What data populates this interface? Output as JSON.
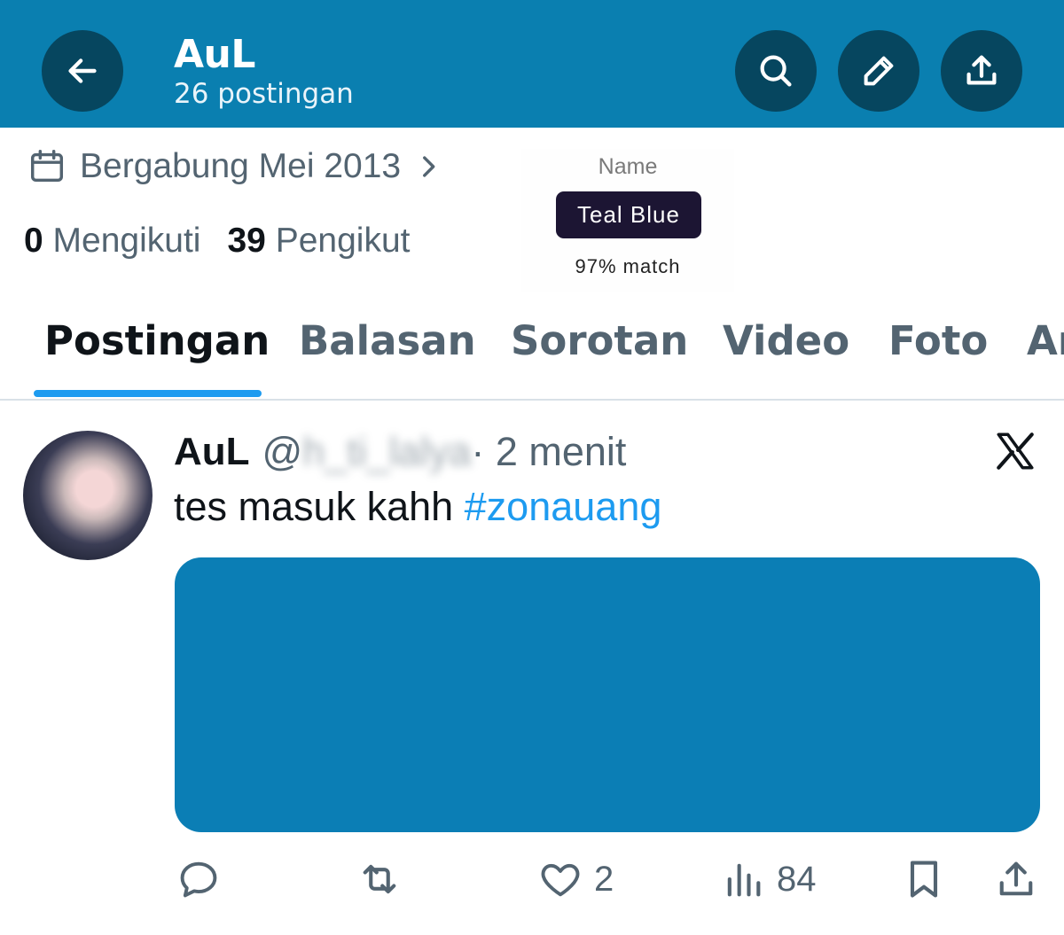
{
  "header": {
    "title": "AuL",
    "post_count": "26 postingan",
    "bg_color": "#0a7fb0"
  },
  "profile": {
    "joined": "Bergabung Mei 2013",
    "following_count": "0",
    "following_label": "Mengikuti",
    "followers_count": "39",
    "followers_label": "Pengikut"
  },
  "color_popup": {
    "label": "Name",
    "value": "Teal Blue",
    "match": "97% match"
  },
  "tabs": [
    {
      "label": "Postingan",
      "active": true
    },
    {
      "label": "Balasan",
      "active": false
    },
    {
      "label": "Sorotan",
      "active": false
    },
    {
      "label": "Video",
      "active": false
    },
    {
      "label": "Foto",
      "active": false
    },
    {
      "label": "Ar",
      "active": false
    }
  ],
  "post": {
    "name": "AuL",
    "handle_prefix": "@",
    "handle_blurred": "h_ti_lalya",
    "time": " · 2 menit",
    "text": "tes masuk kahh ",
    "hashtag": "#zonauang",
    "media_color": "#0b7eb5",
    "likes": "2",
    "views": "84"
  },
  "icons": [
    "back-arrow-icon",
    "search-icon",
    "pencil-icon",
    "share-icon",
    "calendar-icon",
    "chevron-right-icon",
    "x-logo-icon",
    "reply-icon",
    "repost-icon",
    "heart-icon",
    "views-icon",
    "bookmark-icon"
  ]
}
